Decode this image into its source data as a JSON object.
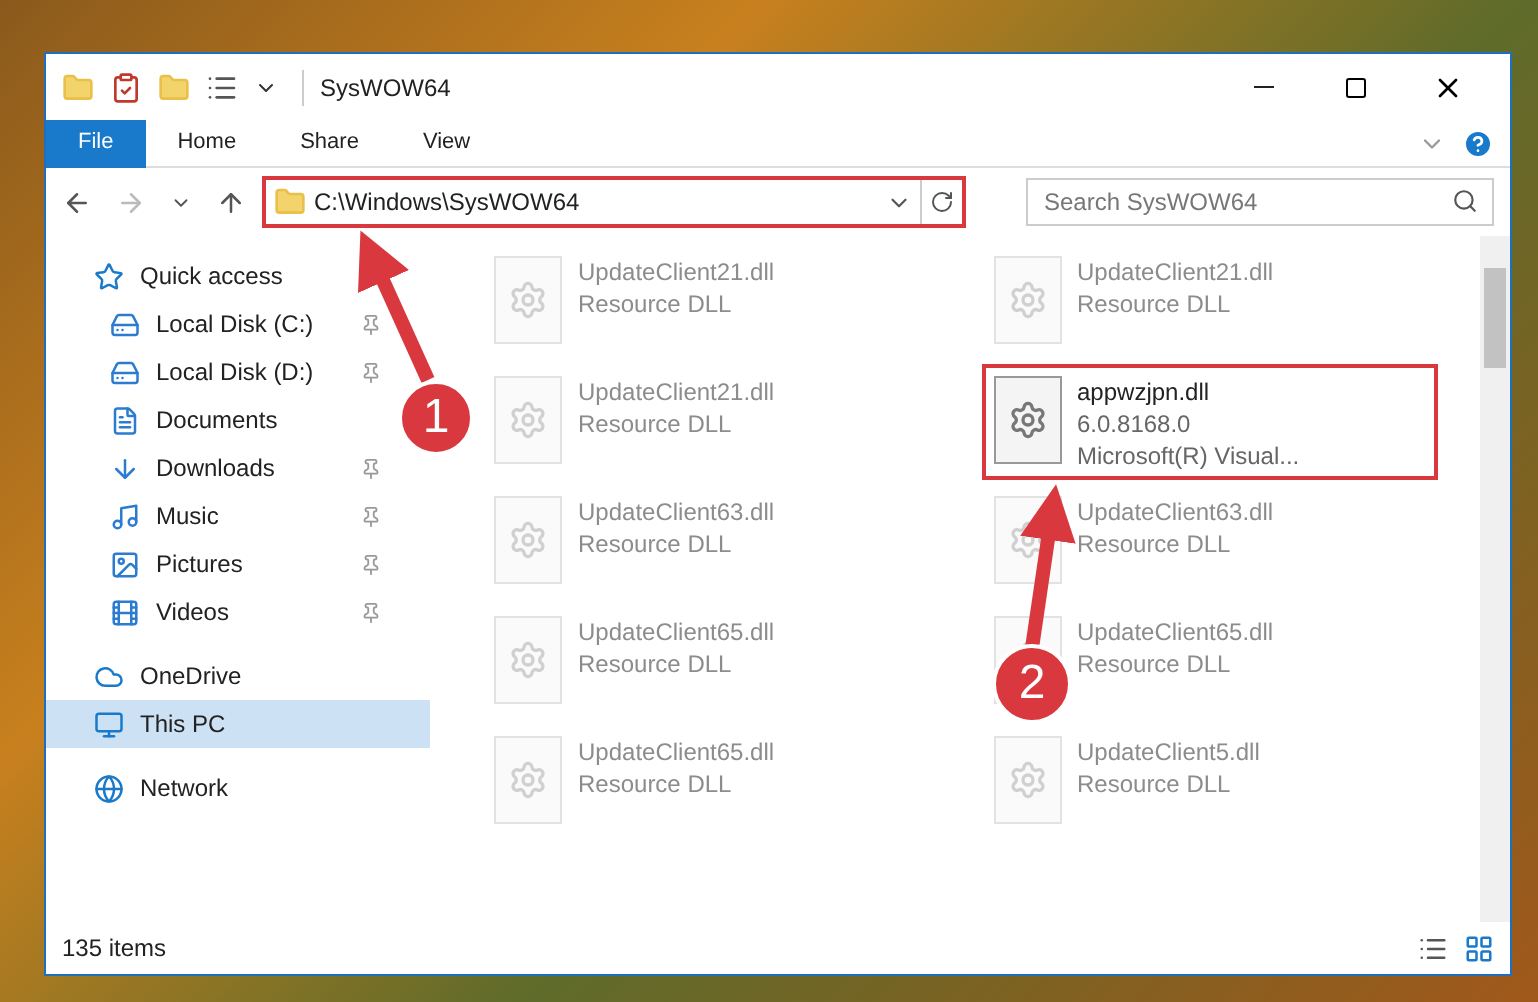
{
  "window": {
    "title": "SysWOW64"
  },
  "ribbon": {
    "tabs": [
      {
        "label": "File",
        "kind": "menu"
      },
      {
        "label": "Home",
        "kind": "tab"
      },
      {
        "label": "Share",
        "kind": "tab"
      },
      {
        "label": "View",
        "kind": "tab"
      }
    ]
  },
  "address_bar": {
    "path": "C:\\Windows\\SysWOW64",
    "highlighted": true
  },
  "search": {
    "placeholder": "Search SysWOW64"
  },
  "sidebar": {
    "items": [
      {
        "label": "Quick access",
        "selected": false,
        "children": [
          {
            "label": "Local Disk (C:)",
            "pinned": true,
            "selected": false
          },
          {
            "label": "Local Disk (D:)",
            "pinned": true,
            "selected": false
          },
          {
            "label": "Documents",
            "pinned": false,
            "selected": false
          },
          {
            "label": "Downloads",
            "pinned": true,
            "selected": false
          },
          {
            "label": "Music",
            "pinned": true,
            "selected": false
          },
          {
            "label": "Pictures",
            "pinned": true,
            "selected": false
          },
          {
            "label": "Videos",
            "pinned": true,
            "selected": false
          }
        ]
      },
      {
        "label": "OneDrive",
        "selected": false
      },
      {
        "label": "This PC",
        "selected": true
      },
      {
        "label": "Network",
        "selected": false
      }
    ]
  },
  "files": [
    {
      "name": "UpdateClient21.dll",
      "line_2": "Resource DLL",
      "blurred": true,
      "highlighted": false
    },
    {
      "name": "UpdateClient21.dll",
      "line_2": "Resource DLL",
      "blurred": true,
      "highlighted": false
    },
    {
      "name": "UpdateClient21.dll",
      "line_2": "Resource DLL",
      "blurred": true,
      "highlighted": false
    },
    {
      "name": "appwzjpn.dll",
      "line_2": "6.0.8168.0",
      "line_3": "Microsoft(R) Visual...",
      "blurred": false,
      "highlighted": true
    },
    {
      "name": "UpdateClient63.dll",
      "line_2": "Resource DLL",
      "blurred": true,
      "highlighted": false
    },
    {
      "name": "UpdateClient63.dll",
      "line_2": "Resource DLL",
      "blurred": true,
      "highlighted": false
    },
    {
      "name": "UpdateClient65.dll",
      "line_2": "Resource DLL",
      "blurred": true,
      "highlighted": false
    },
    {
      "name": "UpdateClient65.dll",
      "line_2": "Resource DLL",
      "blurred": true,
      "highlighted": false
    },
    {
      "name": "UpdateClient65.dll",
      "line_2": "Resource DLL",
      "blurred": true,
      "highlighted": false
    },
    {
      "name": "UpdateClient5.dll",
      "line_2": "Resource DLL",
      "blurred": true,
      "highlighted": false
    }
  ],
  "status_bar": {
    "count": "135 items"
  },
  "annotations": [
    {
      "label": "1"
    },
    {
      "label": "2"
    }
  ]
}
